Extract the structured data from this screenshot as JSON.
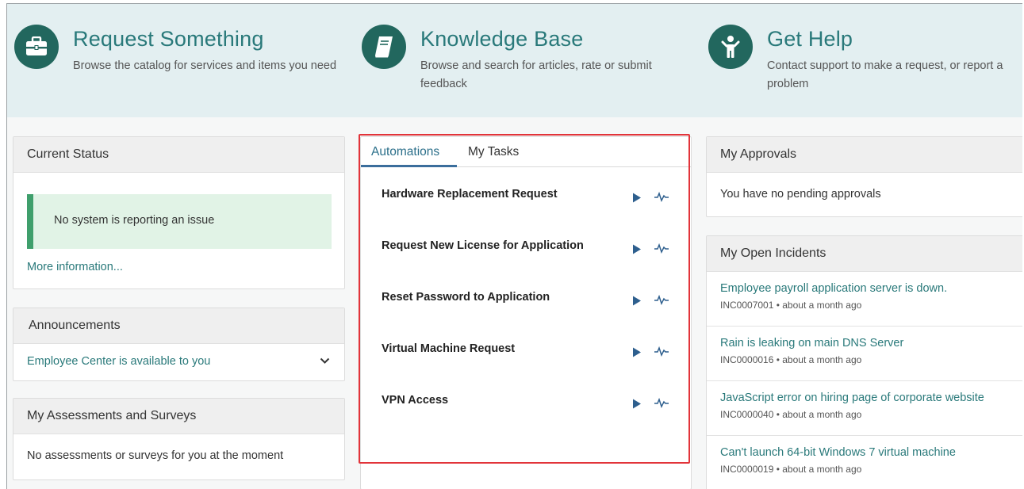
{
  "hero": {
    "items": [
      {
        "title": "Request Something",
        "desc": "Browse the catalog for services and items you need",
        "icon": "briefcase-icon"
      },
      {
        "title": "Knowledge Base",
        "desc": "Browse and search for articles, rate or submit feedback",
        "icon": "book-icon"
      },
      {
        "title": "Get Help",
        "desc": "Contact support to make a request, or report a problem",
        "icon": "person-icon"
      }
    ]
  },
  "current_status": {
    "title": "Current Status",
    "message": "No system is reporting an issue",
    "more_link": "More information..."
  },
  "announcements": {
    "title": "Announcements",
    "item": "Employee Center is available to you"
  },
  "assessments": {
    "title": "My Assessments and Surveys",
    "empty": "No assessments or surveys for you at the moment"
  },
  "automations": {
    "tabs": [
      "Automations",
      "My Tasks"
    ],
    "items": [
      "Hardware Replacement Request",
      "Request New License for Application",
      "Reset Password to Application",
      "Virtual Machine Request",
      "VPN Access"
    ]
  },
  "approvals": {
    "title": "My Approvals",
    "empty": "You have no pending approvals"
  },
  "incidents": {
    "title": "My Open Incidents",
    "items": [
      {
        "title": "Employee payroll application server is down.",
        "meta": "INC0007001 • about a month ago"
      },
      {
        "title": "Rain is leaking on main DNS Server",
        "meta": "INC0000016 • about a month ago"
      },
      {
        "title": "JavaScript error on hiring page of corporate website",
        "meta": "INC0000040 • about a month ago"
      },
      {
        "title": "Can't launch 64-bit Windows 7 virtual machine",
        "meta": "INC0000019 • about a month ago"
      }
    ]
  },
  "colors": {
    "accent": "#29797a",
    "hero_bg": "#e3eff1",
    "icon_circle": "#22675e",
    "status_ok": "#3f9f6c",
    "highlight": "#e2343a"
  }
}
